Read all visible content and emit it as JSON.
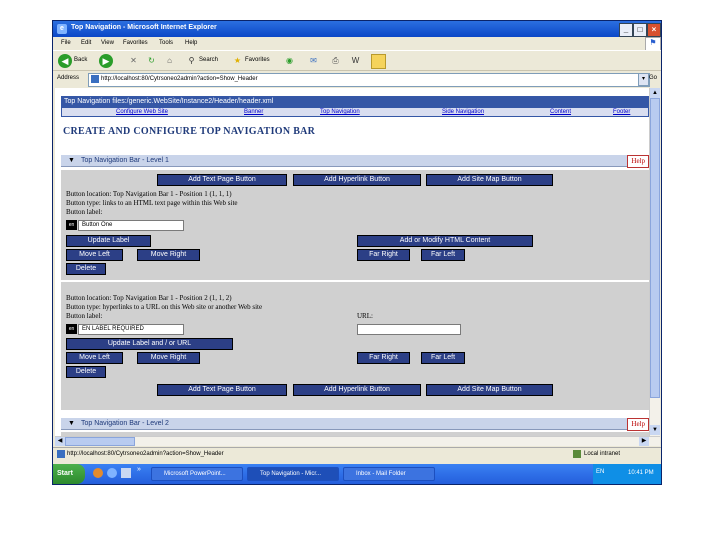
{
  "window": {
    "title": "Top Navigation - Microsoft Internet Explorer"
  },
  "menu": [
    "File",
    "Edit",
    "View",
    "Favorites",
    "Tools",
    "Help"
  ],
  "toolbar": {
    "back_label": "Back",
    "search_label": "Search",
    "favorites_label": "Favorites"
  },
  "address": {
    "label": "Address",
    "url": "http://localhost:80/Cytrsoneo2admin?action=Show_Header",
    "go_label": "Go"
  },
  "page": {
    "path": "Top Navigation files:/generic.WebSite/Instance2/Header/header.xml",
    "nav_links": [
      "Configure Web Site",
      "Banner",
      "Top Navigation",
      "Side Navigation",
      "Content",
      "Footer"
    ],
    "heading": "CREATE AND CONFIGURE TOP NAVIGATION BAR",
    "level1_label": "Top Navigation Bar - Level 1",
    "level2_label": "Top Navigation Bar - Level 2",
    "help_label": "Help",
    "add_text_page_button": "Add Text Page Button",
    "add_hyperlink_button": "Add Hyperlink Button",
    "add_site_map_button": "Add Site Map Button",
    "button1": {
      "location": "Button location: Top Navigation Bar 1 - Position 1 (1, 1, 1)",
      "type": "Button type: links to an HTML text page within this Web site",
      "label_caption": "Button label:",
      "label_value": "Button One",
      "update_label": "Update Label",
      "add_modify_html": "Add or Modify HTML Content",
      "move_left": "Move Left",
      "move_right": "Move Right",
      "far_right": "Far Right",
      "far_left": "Far Left",
      "delete": "Delete"
    },
    "button2": {
      "location": "Button location: Top Navigation Bar 1 - Position 2 (1, 1, 2)",
      "type": "Button type: hyperlinks to a URL on this Web site or another Web site",
      "label_caption": "Button label:",
      "url_caption": "URL:",
      "label_value": "EN LABEL REQUIRED",
      "url_value": "",
      "update_label_url": "Update Label and / or URL",
      "move_left": "Move Left",
      "move_right": "Move Right",
      "far_right": "Far Right",
      "far_left": "Far Left",
      "delete": "Delete"
    },
    "lang_badge": "en"
  },
  "status": {
    "url": "http://localhost:80/Cytrsoneo2admin?action=Show_Header",
    "zone": "Local intranet"
  },
  "taskbar": {
    "start": "Start",
    "tasks": [
      "Microsoft PowerPoint...",
      "Top Navigation - Micr...",
      "Inbox - Mail Folder"
    ],
    "lang": "EN",
    "time": "10:41 PM"
  },
  "colors": {
    "title_blue": "#0b47c7",
    "button_navy": "#2c3f86",
    "panel_gray": "#d0d0d0",
    "section_blue": "#c9d4ea"
  }
}
